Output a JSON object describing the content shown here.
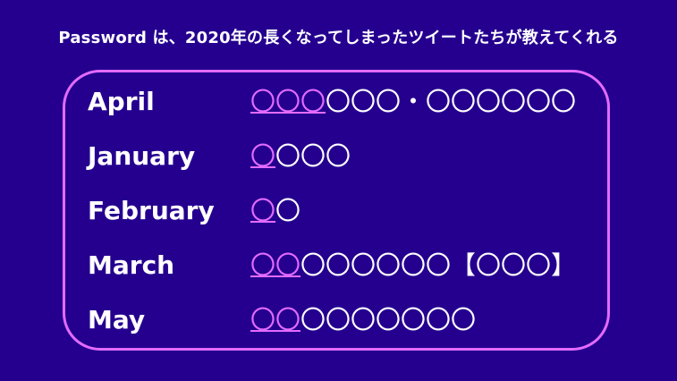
{
  "title": "Password は、2020年の長くなってしまったツイートたちが教えてくれる",
  "rows": [
    {
      "month": "April",
      "highlight": "〇〇〇",
      "rest": "〇〇〇・〇〇〇〇〇〇"
    },
    {
      "month": "January",
      "highlight": "〇",
      "rest": "〇〇〇"
    },
    {
      "month": "February",
      "highlight": "〇",
      "rest": "〇"
    },
    {
      "month": "March",
      "highlight": "〇〇",
      "rest": "〇〇〇〇〇〇【〇〇〇】"
    },
    {
      "month": "May",
      "highlight": "〇〇",
      "rest": "〇〇〇〇〇〇〇"
    }
  ],
  "colors": {
    "background": "#25008f",
    "accent": "#e36bff",
    "text": "#ffffff"
  }
}
